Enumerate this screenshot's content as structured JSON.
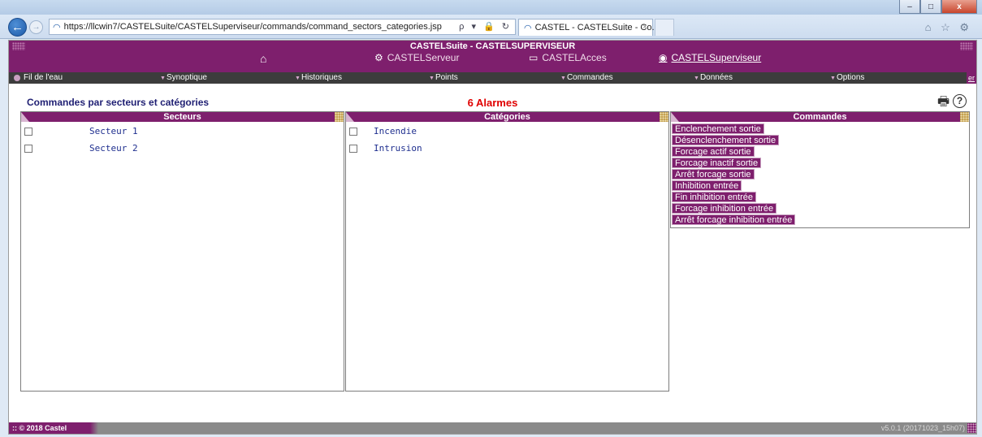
{
  "window": {
    "controls": [
      "–",
      "□",
      "x"
    ]
  },
  "browser": {
    "url": "https://llcwin7/CASTELSuite/CASTELSuperviseur/commands/command_sectors_categories.jsp",
    "url_tools": "ρ ▾ 🔒 ↻",
    "tab_title": "CASTEL - CASTELSuite - Co...",
    "tab_close": "×",
    "toolbar_icons": "⌂ ☆ ⚙"
  },
  "app": {
    "title": "CASTELSuite - CASTELSUPERVISEUR",
    "modules": [
      {
        "label": "CASTELServeur",
        "icon": "gears-icon"
      },
      {
        "label": "CASTELAcces",
        "icon": "card-reader-icon"
      },
      {
        "label": "CASTELSuperviseur",
        "icon": "eye-icon"
      }
    ],
    "menu": [
      "Fil de l'eau",
      "Synoptique",
      "Historiques",
      "Points",
      "Commandes",
      "Données",
      "Options"
    ],
    "menu_end": "er"
  },
  "page": {
    "title": "Commandes par secteurs et catégories",
    "alarms": "6 Alarmes"
  },
  "panels": {
    "sectors": {
      "title": "Secteurs",
      "items": [
        "Secteur 1",
        "Secteur 2"
      ]
    },
    "categories": {
      "title": "Catégories",
      "items": [
        "Incendie",
        "Intrusion"
      ]
    },
    "commands": {
      "title": "Commandes",
      "items": [
        "Enclenchement sortie",
        "Désenclenchement sortie",
        "Forcage actif sortie",
        "Forcage inactif sortie",
        "Arrêt forcage sortie",
        "Inhibition entrée",
        "Fin inhibition entrée",
        "Forcage inhibition entrée",
        "Arrêt forcage inhibition entrée"
      ]
    }
  },
  "footer": {
    "copyright": ":: © 2018 Castel",
    "version": "v5.0.1 (20171023_15h07)"
  },
  "colors": {
    "brand": "#7e1f6d",
    "menu_bg": "#3c3c3c",
    "alarm": "#e00000",
    "title": "#1f1f73"
  }
}
